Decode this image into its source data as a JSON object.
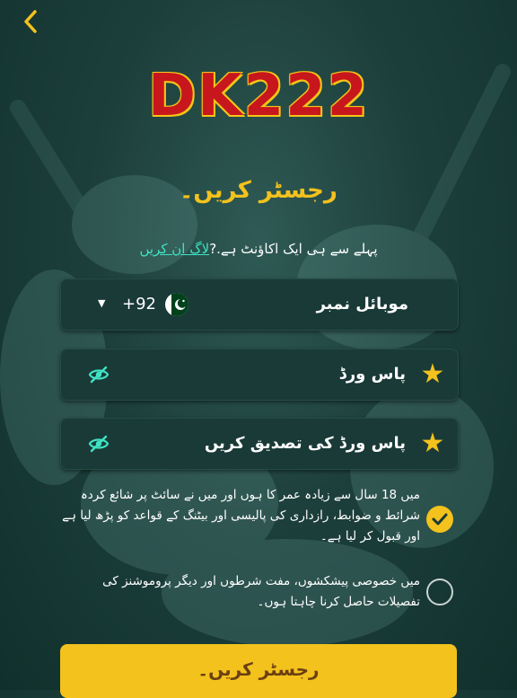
{
  "header": {
    "back_icon": "chevron-left-icon"
  },
  "brand": {
    "logo_text": "DK222"
  },
  "page": {
    "title": "رجسٹر کریں۔"
  },
  "login_prompt": {
    "text": "پہلے سے ہی ایک اکاؤنٹ ہے.?",
    "link_label": "لاگ ان کریں"
  },
  "form": {
    "phone": {
      "label": "موبائل نمبر",
      "country_code": "+92",
      "country_flag": "pakistan-flag-icon",
      "dropdown_icon": "caret-down-icon"
    },
    "password": {
      "label": "پاس ورڈ",
      "icon": "star-icon",
      "toggle_icon": "eye-slash-icon"
    },
    "confirm_password": {
      "label": "پاس ورڈ کی تصدیق کریں",
      "icon": "star-icon",
      "toggle_icon": "eye-slash-icon"
    }
  },
  "consents": [
    {
      "text": "میں 18 سال سے زیادہ عمر کا ہوں اور میں نے سائٹ پر شائع کردہ شرائط و ضوابط، رازداری کی پالیسی اور بیٹنگ کے قواعد کو پڑھ لیا ہے اور قبول کر لیا ہے۔",
      "checked": true
    },
    {
      "text": "میں خصوصی پیشکشوں، مفت شرطوں اور دیگر پروموشنز کی تفصیلات حاصل کرنا چاہتا ہوں۔",
      "checked": false
    }
  ],
  "submit": {
    "label": "رجسٹر کریں۔"
  },
  "colors": {
    "accent": "#f3c21d",
    "link": "#3fe3c4",
    "field_bg": "#193a37",
    "logo_red": "#c8161d"
  }
}
